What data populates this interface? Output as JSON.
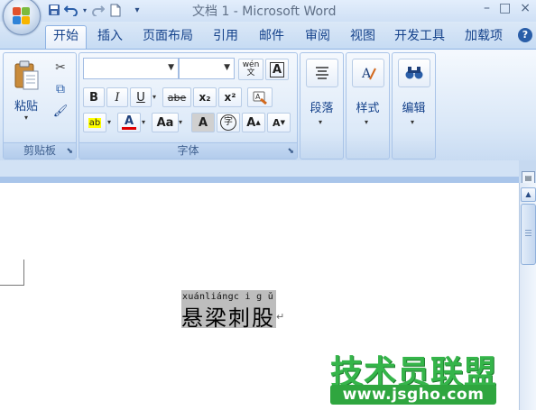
{
  "window": {
    "title": "文档 1 - Microsoft Word",
    "controls": {
      "minimize": "–",
      "maximize": "□",
      "close": "×"
    }
  },
  "quick_access": {
    "save": "💾",
    "undo": "↶",
    "redo": "↷",
    "new": "▭",
    "customize": "▾"
  },
  "tabs": [
    {
      "label": "开始",
      "active": true
    },
    {
      "label": "插入"
    },
    {
      "label": "页面布局"
    },
    {
      "label": "引用"
    },
    {
      "label": "邮件"
    },
    {
      "label": "审阅"
    },
    {
      "label": "视图"
    },
    {
      "label": "开发工具"
    },
    {
      "label": "加载项"
    }
  ],
  "help_label": "?",
  "ribbon": {
    "clipboard": {
      "label": "剪贴板",
      "paste_label": "粘贴",
      "cut_icon": "✂",
      "copy_icon": "⧉",
      "format_painter_icon": "🖌"
    },
    "font": {
      "label": "字体",
      "font_name": "",
      "font_size": "",
      "phonetic_guide": "wén 文",
      "char_border": "A",
      "bold": "B",
      "italic": "I",
      "underline": "U",
      "strikethrough": "abe",
      "subscript": "x₂",
      "superscript": "x²",
      "clear_format": "A",
      "highlight": "ab",
      "font_color": "A",
      "change_case": "Aa",
      "char_shading": "A",
      "enclose_char": "字",
      "grow_font": "A",
      "shrink_font": "A"
    },
    "paragraph": {
      "label": "段落"
    },
    "styles": {
      "label": "样式"
    },
    "editing": {
      "label": "编辑"
    }
  },
  "document": {
    "pinyin": "xuánliángc i g ǔ",
    "text": "悬梁刺股",
    "paragraph_mark": "↵"
  },
  "watermark": {
    "title": "技术员联盟",
    "url": "www.jsgho.com"
  },
  "colors": {
    "accent": "#15428b",
    "highlight_yellow": "#ffff00",
    "font_red": "#e00000",
    "watermark_green": "#35b54a"
  }
}
